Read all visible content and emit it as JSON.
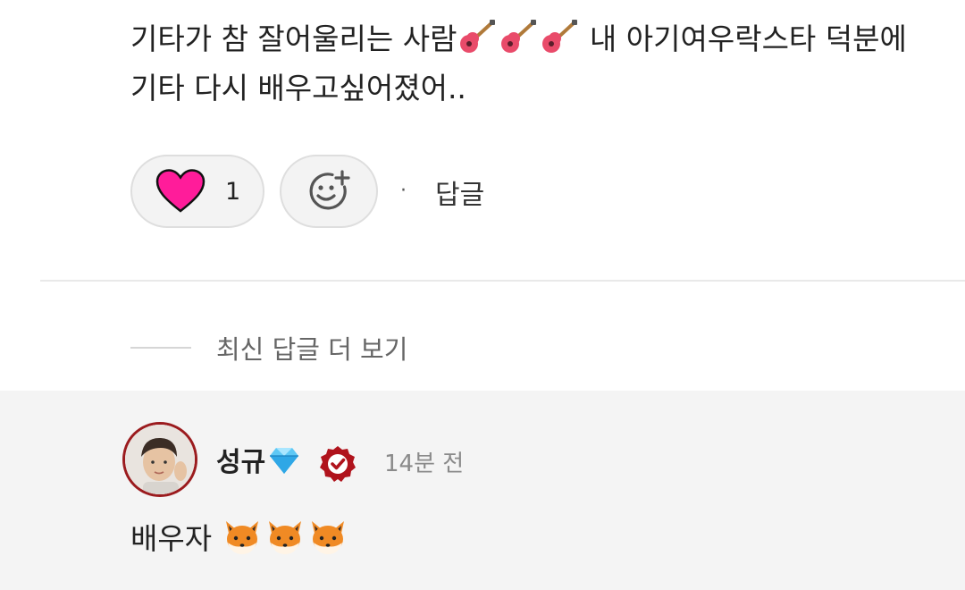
{
  "comment": {
    "text_part1": "기타가 참 잘어울리는 사람",
    "text_part2": " 내 아기여우락스타 덕분에 기타 다시 배우고싶어졌어..",
    "emoji_icons": [
      "guitar-icon",
      "guitar-icon",
      "guitar-icon"
    ],
    "like_count": "1",
    "reply_label": "답글",
    "separator_dot": "·"
  },
  "more_replies": {
    "label": "최신 답글 더 보기"
  },
  "reply": {
    "author": "성규",
    "author_badge_icon": "diamond-icon",
    "verified_icon": "verified-badge-icon",
    "time": "14분 전",
    "text": "배우자",
    "emoji_icons": [
      "fox-face-icon",
      "fox-face-icon",
      "fox-face-icon"
    ]
  },
  "colors": {
    "heart": "#ff1c9a",
    "avatar_ring": "#9b1b1e",
    "verified_badge": "#b0131c",
    "reply_background": "#f4f4f4"
  }
}
